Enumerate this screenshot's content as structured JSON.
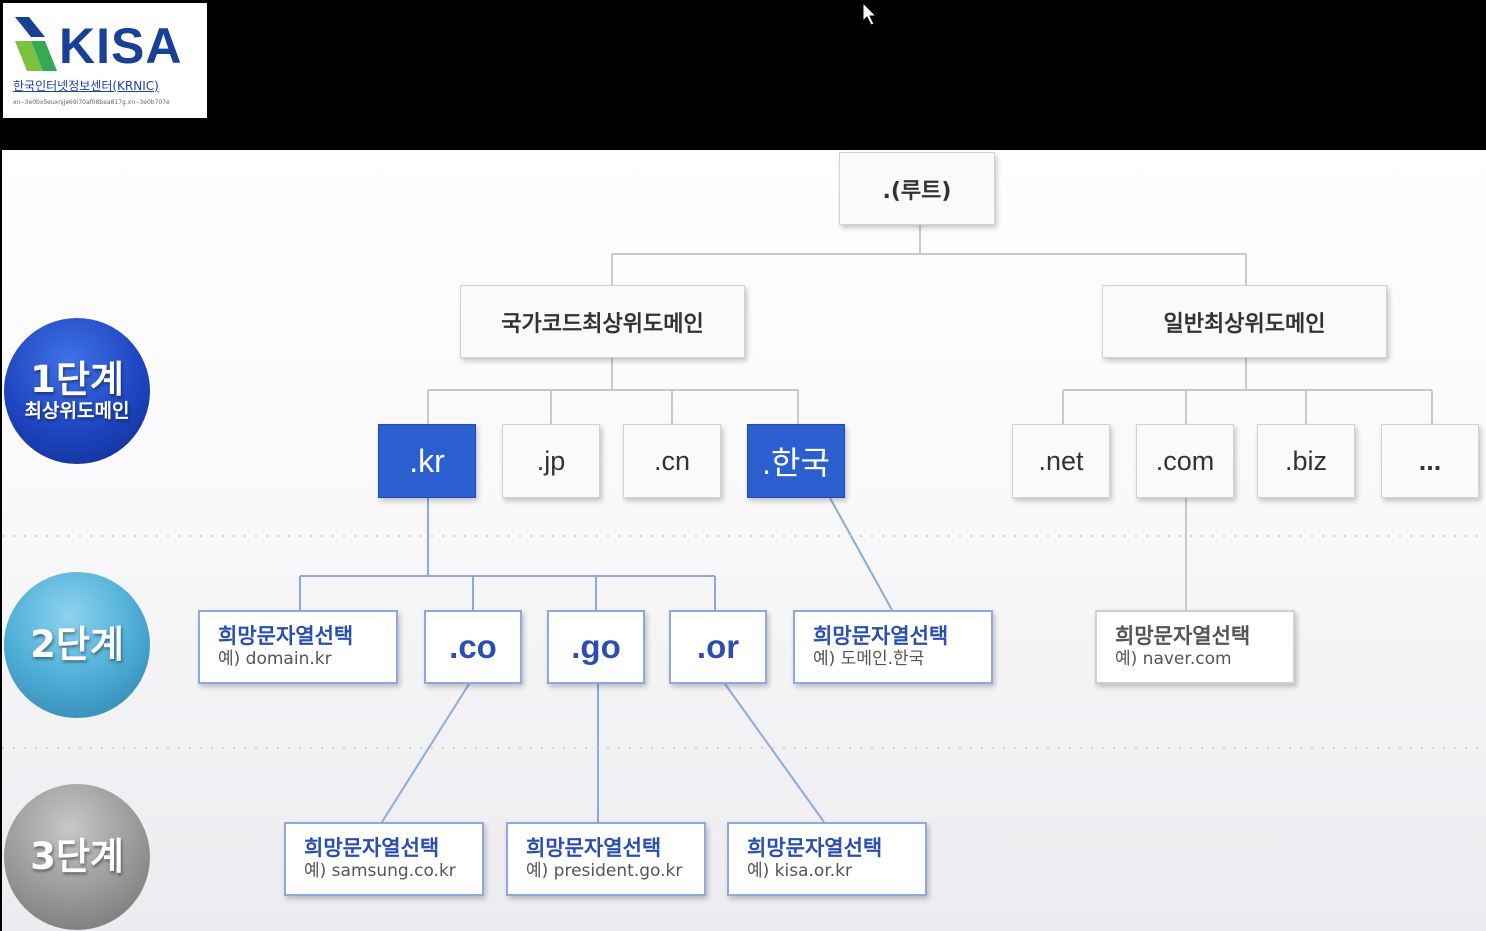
{
  "logo": {
    "brand": "KISA",
    "subtitle": "한국인터넷정보센터(KRNIC)",
    "url": "xn--3e0bx5euxnjje69i70af08bea817g.xn--3e0b707e"
  },
  "levels": [
    {
      "label": "1단계",
      "sub": "최상위도메인"
    },
    {
      "label": "2단계",
      "sub": ""
    },
    {
      "label": "3단계",
      "sub": ""
    }
  ],
  "tree": {
    "root": ".(루트)",
    "cctld_group": "국가코드최상위도메인",
    "gtld_group": "일반최상위도메인",
    "cctlds": [
      ".kr",
      ".jp",
      ".cn",
      ".한국"
    ],
    "gtlds": [
      ".net",
      ".com",
      ".biz",
      "..."
    ],
    "second_level": [
      ".co",
      ".go",
      ".or"
    ],
    "choose_label": "희망문자열선택",
    "examples": {
      "domain_kr": "예) domain.kr",
      "hangul": "예) 도메인.한국",
      "naver": "예) naver.com",
      "samsung": "예) samsung.co.kr",
      "president": "예) president.go.kr",
      "kisa": "예) kisa.or.kr"
    }
  },
  "colors": {
    "selected": "#2b5fcf",
    "accent_text": "#2a4fb0",
    "level1": "#1e45c0",
    "level2": "#4eaed6",
    "level3": "#9b9b9b"
  }
}
